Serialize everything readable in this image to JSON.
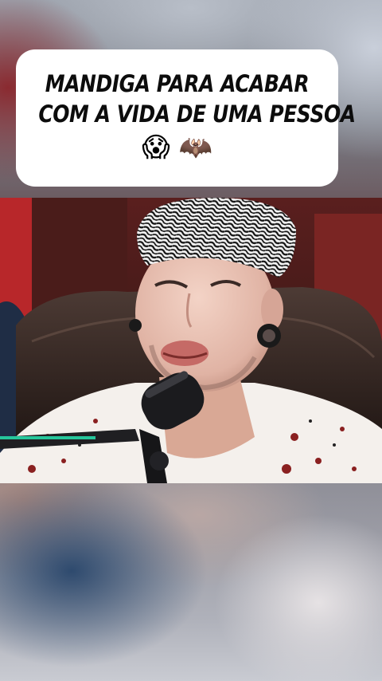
{
  "caption": {
    "line1": "MANDIGA PARA ACABAR",
    "line2": "COM A VIDA DE UMA PESSOA",
    "emoji_scream": "😱",
    "emoji_bat": "🦇"
  },
  "colors": {
    "caption_bg": "#ffffff",
    "caption_text": "#0c0c0c",
    "mic_ring": "#27d8a8"
  },
  "icons": [
    "face-screaming-in-fear-emoji",
    "bat-emoji"
  ]
}
